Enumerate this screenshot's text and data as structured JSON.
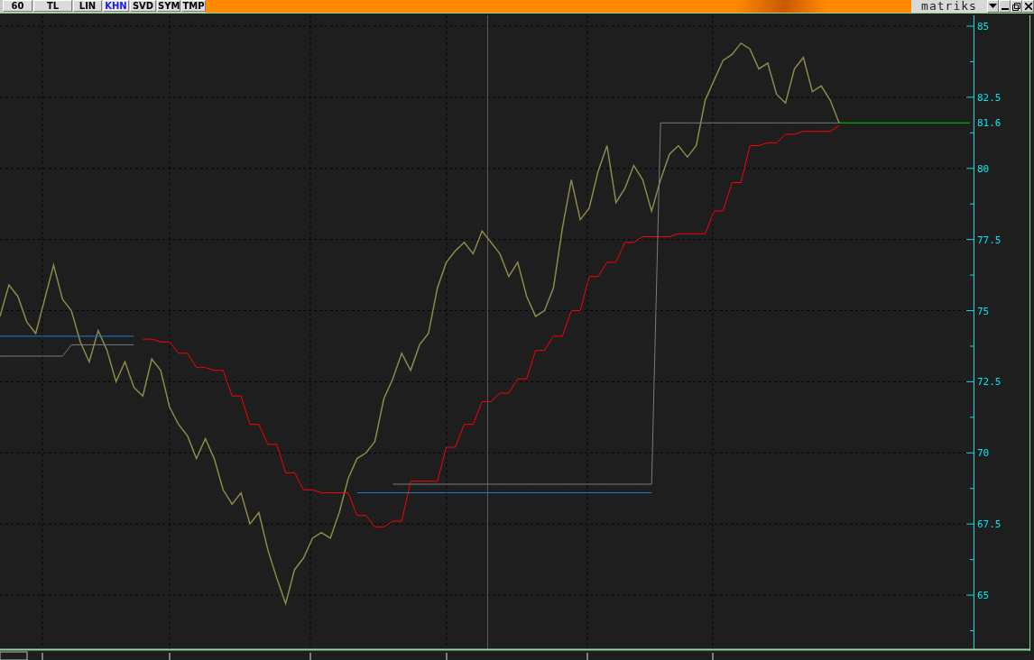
{
  "toolbar": {
    "buttons": [
      {
        "label": "60",
        "selected": false
      },
      {
        "label": "TL",
        "selected": false
      },
      {
        "label": "LIN",
        "selected": false
      },
      {
        "label": "KHN",
        "selected": true
      },
      {
        "label": "SVD",
        "selected": false
      },
      {
        "label": "SYM",
        "selected": false
      },
      {
        "label": "TMP",
        "selected": false
      }
    ],
    "logo": "matriks"
  },
  "chart": {
    "chart_data": {
      "type": "line",
      "grid": true,
      "categories": [
        null,
        null,
        null,
        null,
        null,
        null,
        null,
        null,
        null,
        null,
        null,
        null,
        null,
        null,
        null,
        null,
        null,
        null,
        null,
        null,
        null,
        null,
        null,
        null,
        null,
        null,
        null,
        null,
        null,
        null,
        null,
        null,
        null,
        null,
        null,
        null,
        null,
        null,
        null,
        null,
        null,
        null,
        null,
        null,
        null,
        null,
        null,
        null,
        null,
        null,
        null,
        null,
        null,
        null,
        null,
        null,
        null,
        null,
        null,
        null,
        null,
        null,
        null,
        null,
        null,
        null,
        null,
        null,
        null,
        null,
        null,
        null,
        null,
        null,
        null,
        null,
        null,
        null,
        null,
        null,
        null,
        null,
        null,
        null,
        null,
        null,
        null,
        null,
        null,
        null,
        null,
        null,
        null,
        null,
        null
      ],
      "ylim": [
        63.1,
        85.38
      ],
      "yticks": [
        {
          "value": 65,
          "label": "65"
        },
        {
          "value": 67.5,
          "label": "67.5"
        },
        {
          "value": 70,
          "label": "70"
        },
        {
          "value": 72.5,
          "label": "72.5"
        },
        {
          "value": 75,
          "label": "75"
        },
        {
          "value": 77.5,
          "label": "77.5"
        },
        {
          "value": 80,
          "label": "80"
        },
        {
          "value": 82.5,
          "label": "82.5"
        },
        {
          "value": 85,
          "label": "85"
        }
      ],
      "series": [
        {
          "color": "#8c8a4a",
          "values": [
            74.8,
            75.9,
            75.5,
            74.6,
            74.2,
            75.4,
            76.6,
            75.4,
            75.0,
            73.9,
            73.2,
            74.3,
            73.6,
            72.5,
            73.2,
            72.3,
            72.0,
            73.3,
            72.9,
            71.6,
            71.0,
            70.6,
            69.8,
            70.5,
            69.8,
            68.7,
            68.2,
            68.6,
            67.5,
            67.9,
            66.6,
            65.6,
            64.7,
            65.9,
            66.3,
            67.0,
            67.2,
            67.0,
            67.9,
            69.1,
            69.8,
            70.0,
            70.4,
            71.9,
            72.6,
            73.5,
            72.9,
            73.8,
            74.2,
            75.8,
            76.7,
            77.1,
            77.4,
            77.0,
            77.8,
            77.4,
            77.0,
            76.2,
            76.7,
            75.5,
            74.8,
            75.0,
            75.8,
            77.9,
            79.6,
            78.2,
            78.6,
            79.9,
            80.8,
            78.8,
            79.3,
            80.1,
            79.6,
            78.5,
            79.6,
            80.5,
            80.8,
            80.4,
            80.8,
            82.4,
            83.1,
            83.8,
            84.0,
            84.4,
            84.2,
            83.5,
            83.7,
            82.6,
            82.3,
            83.5,
            83.9,
            82.7,
            82.9,
            82.4,
            81.6
          ]
        },
        {
          "color": "#ff0000",
          "values": [
            null,
            null,
            null,
            null,
            null,
            null,
            null,
            null,
            null,
            null,
            null,
            null,
            null,
            null,
            null,
            null,
            74.0,
            74.0,
            73.9,
            73.9,
            73.5,
            73.5,
            73.0,
            73.0,
            72.9,
            72.9,
            72.0,
            72.0,
            71.0,
            71.0,
            70.3,
            70.3,
            69.3,
            69.3,
            68.7,
            68.7,
            68.6,
            68.6,
            68.6,
            68.6,
            67.8,
            67.8,
            67.4,
            67.4,
            67.6,
            67.6,
            69.0,
            69.0,
            69.0,
            69.0,
            70.2,
            70.2,
            71.0,
            71.0,
            71.8,
            71.8,
            72.1,
            72.1,
            72.6,
            72.6,
            73.6,
            73.6,
            74.1,
            74.1,
            75.0,
            75.0,
            76.2,
            76.2,
            76.7,
            76.7,
            77.4,
            77.4,
            77.6,
            77.6,
            77.6,
            77.6,
            77.7,
            77.7,
            77.7,
            77.7,
            78.5,
            78.5,
            79.5,
            79.5,
            80.8,
            80.8,
            80.9,
            80.9,
            81.2,
            81.2,
            81.3,
            81.3,
            81.3,
            81.3,
            81.5
          ]
        },
        {
          "color": "#1e7fc8",
          "values": [
            74.1,
            74.1,
            74.1,
            74.1,
            74.1,
            74.1,
            74.1,
            74.1,
            74.1,
            74.1,
            74.1,
            74.1,
            74.1,
            74.1,
            74.1,
            74.1,
            null,
            null,
            null,
            null,
            null,
            null,
            null,
            null,
            null,
            null,
            null,
            null,
            null,
            null,
            null,
            null,
            null,
            null,
            null,
            null,
            null,
            null,
            null,
            null,
            68.6,
            68.6,
            68.6,
            68.6,
            68.6,
            68.6,
            68.6,
            68.6,
            68.6,
            68.6,
            68.6,
            68.6,
            68.6,
            68.6,
            68.6,
            68.6,
            68.6,
            68.6,
            68.6,
            68.6,
            68.6,
            68.6,
            68.6,
            68.6,
            68.6,
            68.6,
            68.6,
            68.6,
            68.6,
            68.6,
            68.6,
            68.6,
            68.6,
            68.6,
            null,
            null,
            null,
            null,
            null,
            null,
            null,
            null,
            null,
            null,
            null,
            null,
            null,
            null,
            null,
            null,
            null,
            null,
            null,
            null,
            null
          ]
        },
        {
          "color": "#7a7a7a",
          "values": [
            73.4,
            73.4,
            73.4,
            73.4,
            73.4,
            73.4,
            73.4,
            73.4,
            73.8,
            73.8,
            73.8,
            73.8,
            73.8,
            73.8,
            73.8,
            73.8,
            null,
            null,
            null,
            null,
            null,
            null,
            null,
            null,
            null,
            null,
            null,
            null,
            null,
            null,
            null,
            null,
            null,
            null,
            null,
            null,
            null,
            null,
            null,
            null,
            null,
            null,
            null,
            null,
            68.9,
            68.9,
            68.9,
            68.9,
            68.9,
            68.9,
            68.9,
            68.9,
            68.9,
            68.9,
            68.9,
            68.9,
            68.9,
            68.9,
            68.9,
            68.9,
            68.9,
            68.9,
            68.9,
            68.9,
            68.9,
            68.9,
            68.9,
            68.9,
            68.9,
            68.9,
            68.9,
            68.9,
            68.9,
            68.9,
            81.6,
            81.6,
            81.6,
            81.6,
            81.6,
            81.6,
            81.6,
            81.6,
            81.6,
            81.6,
            81.6,
            81.6,
            81.6,
            81.6,
            81.6,
            81.6,
            81.6,
            81.6,
            81.6,
            81.6,
            81.6
          ]
        }
      ]
    },
    "last_value_label": "81.6"
  }
}
